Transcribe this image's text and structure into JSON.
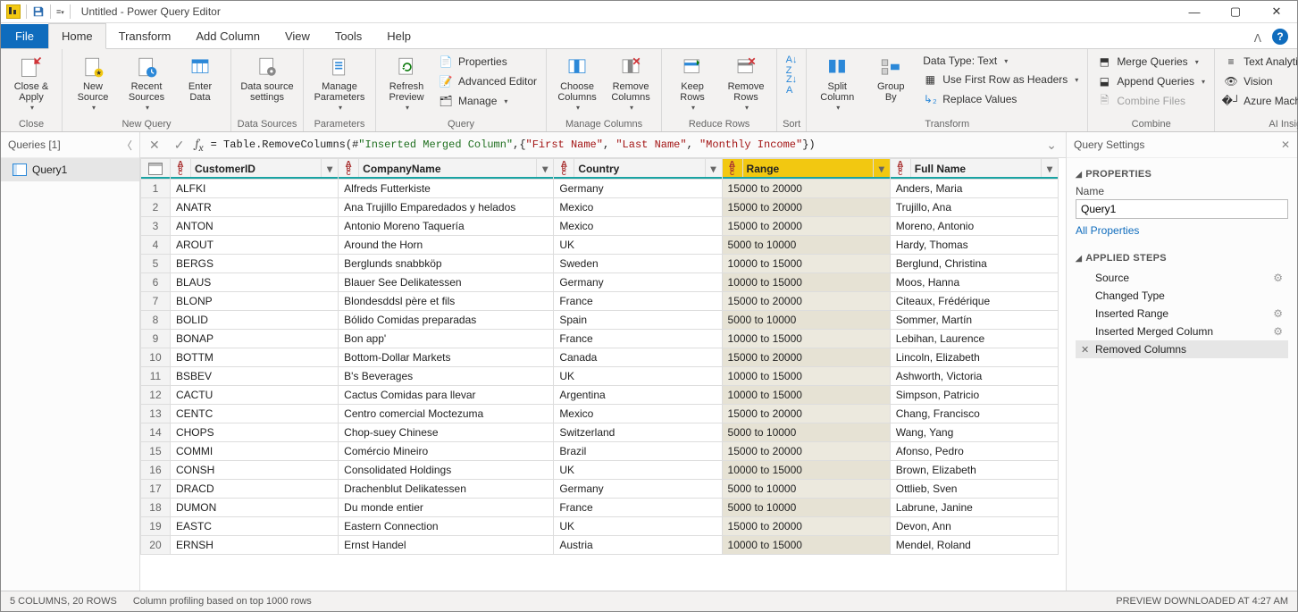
{
  "window_title": "Untitled - Power Query Editor",
  "tabs": {
    "file": "File",
    "home": "Home",
    "transform": "Transform",
    "add": "Add Column",
    "view": "View",
    "tools": "Tools",
    "help": "Help"
  },
  "ribbon": {
    "close_apply": "Close &\nApply",
    "close_group": "Close",
    "new_source": "New\nSource",
    "recent_sources": "Recent\nSources",
    "enter_data": "Enter\nData",
    "new_query_group": "New Query",
    "data_source_settings": "Data source\nsettings",
    "data_sources_group": "Data Sources",
    "manage_parameters": "Manage\nParameters",
    "parameters_group": "Parameters",
    "refresh_preview": "Refresh\nPreview",
    "properties": "Properties",
    "advanced_editor": "Advanced Editor",
    "manage": "Manage",
    "query_group": "Query",
    "choose_columns": "Choose\nColumns",
    "remove_columns": "Remove\nColumns",
    "manage_columns_group": "Manage Columns",
    "keep_rows": "Keep\nRows",
    "remove_rows": "Remove\nRows",
    "reduce_rows_group": "Reduce Rows",
    "sort_group": "Sort",
    "split_column": "Split\nColumn",
    "group_by": "Group\nBy",
    "data_type": "Data Type: Text",
    "first_row_headers": "Use First Row as Headers",
    "replace_values": "Replace Values",
    "transform_group": "Transform",
    "merge_queries": "Merge Queries",
    "append_queries": "Append Queries",
    "combine_files": "Combine Files",
    "combine_group": "Combine",
    "text_analytics": "Text Analytics",
    "vision": "Vision",
    "azure_ml": "Azure Machine Learning",
    "ai_group": "AI Insights"
  },
  "queries_panel": {
    "title": "Queries [1]",
    "item": "Query1"
  },
  "formula": {
    "prefix": "= Table.RemoveColumns(#",
    "t1": "\"Inserted Merged Column\"",
    "mid": ",{",
    "s1": "\"First Name\"",
    "c1": ", ",
    "s2": "\"Last Name\"",
    "c2": ", ",
    "s3": "\"Monthly Income\"",
    "suffix": "})"
  },
  "columns": [
    "CustomerID",
    "CompanyName",
    "Country",
    "Range",
    "Full Name"
  ],
  "rows": [
    [
      "ALFKI",
      "Alfreds Futterkiste",
      "Germany",
      "15000 to 20000",
      "Anders, Maria"
    ],
    [
      "ANATR",
      "Ana Trujillo Emparedados y helados",
      "Mexico",
      "15000 to 20000",
      "Trujillo, Ana"
    ],
    [
      "ANTON",
      "Antonio Moreno Taquería",
      "Mexico",
      "15000 to 20000",
      "Moreno, Antonio"
    ],
    [
      "AROUT",
      "Around the Horn",
      "UK",
      "5000 to 10000",
      "Hardy, Thomas"
    ],
    [
      "BERGS",
      "Berglunds snabbköp",
      "Sweden",
      "10000 to 15000",
      "Berglund, Christina"
    ],
    [
      "BLAUS",
      "Blauer See Delikatessen",
      "Germany",
      "10000 to 15000",
      "Moos, Hanna"
    ],
    [
      "BLONP",
      "Blondesddsl père et fils",
      "France",
      "15000 to 20000",
      "Citeaux, Frédérique"
    ],
    [
      "BOLID",
      "Bólido Comidas preparadas",
      "Spain",
      "5000 to 10000",
      "Sommer, Martín"
    ],
    [
      "BONAP",
      "Bon app'",
      "France",
      "10000 to 15000",
      "Lebihan, Laurence"
    ],
    [
      "BOTTM",
      "Bottom-Dollar Markets",
      "Canada",
      "15000 to 20000",
      "Lincoln, Elizabeth"
    ],
    [
      "BSBEV",
      "B's Beverages",
      "UK",
      "10000 to 15000",
      "Ashworth, Victoria"
    ],
    [
      "CACTU",
      "Cactus Comidas para llevar",
      "Argentina",
      "10000 to 15000",
      "Simpson, Patricio"
    ],
    [
      "CENTC",
      "Centro comercial Moctezuma",
      "Mexico",
      "15000 to 20000",
      "Chang, Francisco"
    ],
    [
      "CHOPS",
      "Chop-suey Chinese",
      "Switzerland",
      "5000 to 10000",
      "Wang, Yang"
    ],
    [
      "COMMI",
      "Comércio Mineiro",
      "Brazil",
      "15000 to 20000",
      "Afonso, Pedro"
    ],
    [
      "CONSH",
      "Consolidated Holdings",
      "UK",
      "10000 to 15000",
      "Brown, Elizabeth"
    ],
    [
      "DRACD",
      "Drachenblut Delikatessen",
      "Germany",
      "5000 to 10000",
      "Ottlieb, Sven"
    ],
    [
      "DUMON",
      "Du monde entier",
      "France",
      "5000 to 10000",
      "Labrune, Janine"
    ],
    [
      "EASTC",
      "Eastern Connection",
      "UK",
      "15000 to 20000",
      "Devon, Ann"
    ],
    [
      "ERNSH",
      "Ernst Handel",
      "Austria",
      "10000 to 15000",
      "Mendel, Roland"
    ]
  ],
  "settings": {
    "title": "Query Settings",
    "properties": "PROPERTIES",
    "name_label": "Name",
    "name_value": "Query1",
    "all_props": "All Properties",
    "applied": "APPLIED STEPS",
    "steps": [
      "Source",
      "Changed Type",
      "Inserted Range",
      "Inserted Merged Column",
      "Removed Columns"
    ]
  },
  "status": {
    "left": "5 COLUMNS, 20 ROWS",
    "mid": "Column profiling based on top 1000 rows",
    "right": "PREVIEW DOWNLOADED AT 4:27 AM"
  }
}
